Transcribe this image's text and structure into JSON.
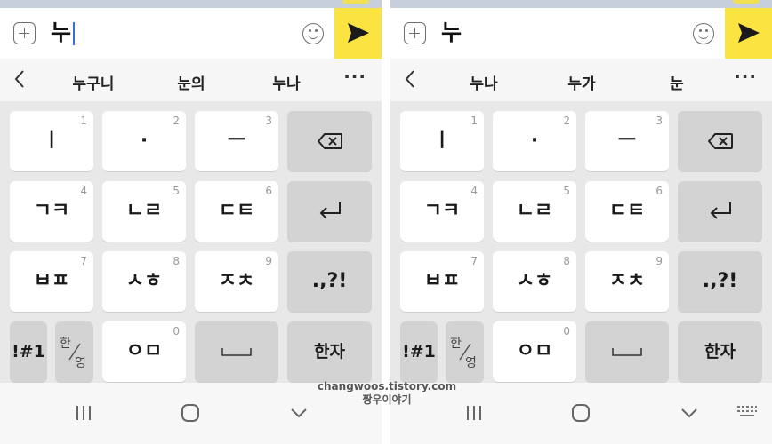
{
  "panels": [
    {
      "input_text": "누",
      "suggestions": [
        "누구니",
        "눈의",
        "누나"
      ],
      "keys": {
        "k1": {
          "label": "ㅣ",
          "num": "1"
        },
        "k2": {
          "label": "·",
          "num": "2"
        },
        "k3": {
          "label": "ㅡ",
          "num": "3"
        },
        "k4": {
          "label": "ㄱㅋ",
          "num": "4"
        },
        "k5": {
          "label": "ㄴㄹ",
          "num": "5"
        },
        "k6": {
          "label": "ㄷㅌ",
          "num": "6"
        },
        "k7": {
          "label": "ㅂㅍ",
          "num": "7"
        },
        "k8": {
          "label": "ㅅㅎ",
          "num": "8"
        },
        "k9": {
          "label": "ㅈㅊ",
          "num": "9"
        },
        "k0": {
          "label": "ㅇㅁ",
          "num": "0"
        },
        "punct": ".,?!",
        "symbols": "!#1",
        "han": "한",
        "young": "영",
        "hanja": "한자"
      }
    },
    {
      "input_text": "누",
      "suggestions": [
        "누나",
        "누가",
        "눈"
      ],
      "keys": {
        "k1": {
          "label": "ㅣ",
          "num": "1"
        },
        "k2": {
          "label": "·",
          "num": "2"
        },
        "k3": {
          "label": "ㅡ",
          "num": "3"
        },
        "k4": {
          "label": "ㄱㅋ",
          "num": "4"
        },
        "k5": {
          "label": "ㄴㄹ",
          "num": "5"
        },
        "k6": {
          "label": "ㄷㅌ",
          "num": "6"
        },
        "k7": {
          "label": "ㅂㅍ",
          "num": "7"
        },
        "k8": {
          "label": "ㅅㅎ",
          "num": "8"
        },
        "k9": {
          "label": "ㅈㅊ",
          "num": "9"
        },
        "k0": {
          "label": "ㅇㅁ",
          "num": "0"
        },
        "punct": ".,?!",
        "symbols": "!#1",
        "han": "한",
        "young": "영",
        "hanja": "한자"
      }
    }
  ],
  "more_label": "···",
  "watermark": {
    "line1": "changwoos.tistory.com",
    "line2": "짱우이야기"
  },
  "icons": {
    "plus": "plus-square-icon",
    "emoji": "smiley-icon",
    "send": "send-arrow-icon",
    "back": "chevron-left-icon",
    "backspace": "backspace-icon",
    "enter": "enter-return-icon",
    "space": "space-bar-icon",
    "recents": "recent-apps-icon",
    "home": "home-icon",
    "hide": "chevron-down-icon",
    "keyboard": "keyboard-icon"
  },
  "colors": {
    "send_bg": "#fbe341",
    "caret": "#3a6fd8",
    "keyboard_bg": "#e8e8e8",
    "func_key": "#d3d3d3"
  }
}
